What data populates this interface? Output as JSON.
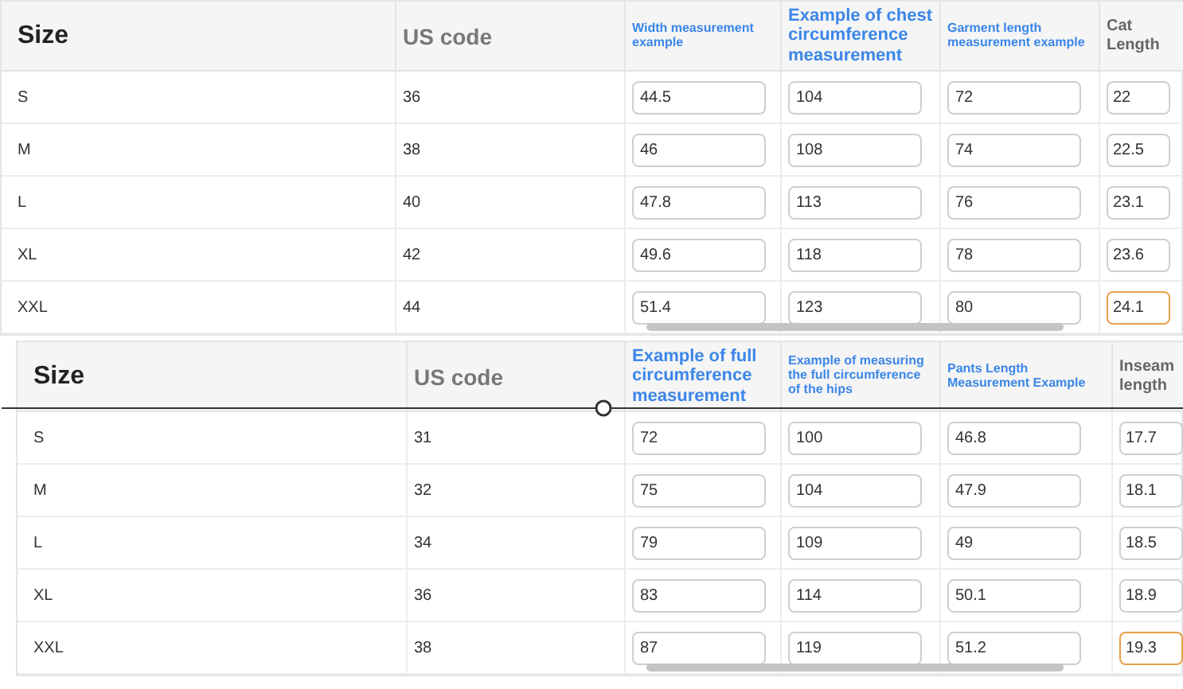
{
  "tables": [
    {
      "columns": [
        {
          "label": "Size",
          "kind": "title"
        },
        {
          "label": "US code",
          "kind": "muted"
        },
        {
          "label": "Width measurement example",
          "kind": "link"
        },
        {
          "label": "Example of chest circumference measurement",
          "kind": "link_large"
        },
        {
          "label": "Garment length measurement example",
          "kind": "link"
        },
        {
          "label": "Cat Length",
          "kind": "muted_small"
        }
      ],
      "rows": [
        {
          "size": "S",
          "us_code": "36",
          "measurements": [
            {
              "value": "44.5",
              "highlighted": false
            },
            {
              "value": "104",
              "highlighted": false
            },
            {
              "value": "72",
              "highlighted": false
            },
            {
              "value": "22",
              "highlighted": false
            }
          ]
        },
        {
          "size": "M",
          "us_code": "38",
          "measurements": [
            {
              "value": "46",
              "highlighted": false
            },
            {
              "value": "108",
              "highlighted": false
            },
            {
              "value": "74",
              "highlighted": false
            },
            {
              "value": "22.5",
              "highlighted": false
            }
          ]
        },
        {
          "size": "L",
          "us_code": "40",
          "measurements": [
            {
              "value": "47.8",
              "highlighted": false
            },
            {
              "value": "113",
              "highlighted": false
            },
            {
              "value": "76",
              "highlighted": false
            },
            {
              "value": "23.1",
              "highlighted": false
            }
          ]
        },
        {
          "size": "XL",
          "us_code": "42",
          "measurements": [
            {
              "value": "49.6",
              "highlighted": false
            },
            {
              "value": "118",
              "highlighted": false
            },
            {
              "value": "78",
              "highlighted": false
            },
            {
              "value": "23.6",
              "highlighted": false
            }
          ]
        },
        {
          "size": "XXL",
          "us_code": "44",
          "measurements": [
            {
              "value": "51.4",
              "highlighted": false
            },
            {
              "value": "123",
              "highlighted": false
            },
            {
              "value": "80",
              "highlighted": false
            },
            {
              "value": "24.1",
              "highlighted": true
            }
          ]
        }
      ]
    },
    {
      "columns": [
        {
          "label": "Size",
          "kind": "title"
        },
        {
          "label": "US code",
          "kind": "muted"
        },
        {
          "label": "Example of full circumference measurement",
          "kind": "link_large"
        },
        {
          "label": "Example of measuring the full circumference of the hips",
          "kind": "link"
        },
        {
          "label": "Pants Length Measurement Example",
          "kind": "link"
        },
        {
          "label": "Inseam length",
          "kind": "muted_small"
        }
      ],
      "rows": [
        {
          "size": "S",
          "us_code": "31",
          "measurements": [
            {
              "value": "72",
              "highlighted": false
            },
            {
              "value": "100",
              "highlighted": false
            },
            {
              "value": "46.8",
              "highlighted": false
            },
            {
              "value": "17.7",
              "highlighted": false
            }
          ]
        },
        {
          "size": "M",
          "us_code": "32",
          "measurements": [
            {
              "value": "75",
              "highlighted": false
            },
            {
              "value": "104",
              "highlighted": false
            },
            {
              "value": "47.9",
              "highlighted": false
            },
            {
              "value": "18.1",
              "highlighted": false
            }
          ]
        },
        {
          "size": "L",
          "us_code": "34",
          "measurements": [
            {
              "value": "79",
              "highlighted": false
            },
            {
              "value": "109",
              "highlighted": false
            },
            {
              "value": "49",
              "highlighted": false
            },
            {
              "value": "18.5",
              "highlighted": false
            }
          ]
        },
        {
          "size": "XL",
          "us_code": "36",
          "measurements": [
            {
              "value": "83",
              "highlighted": false
            },
            {
              "value": "114",
              "highlighted": false
            },
            {
              "value": "50.1",
              "highlighted": false
            },
            {
              "value": "18.9",
              "highlighted": false
            }
          ]
        },
        {
          "size": "XXL",
          "us_code": "38",
          "measurements": [
            {
              "value": "87",
              "highlighted": false
            },
            {
              "value": "119",
              "highlighted": false
            },
            {
              "value": "51.2",
              "highlighted": false
            },
            {
              "value": "19.3",
              "highlighted": true
            }
          ]
        }
      ]
    }
  ]
}
